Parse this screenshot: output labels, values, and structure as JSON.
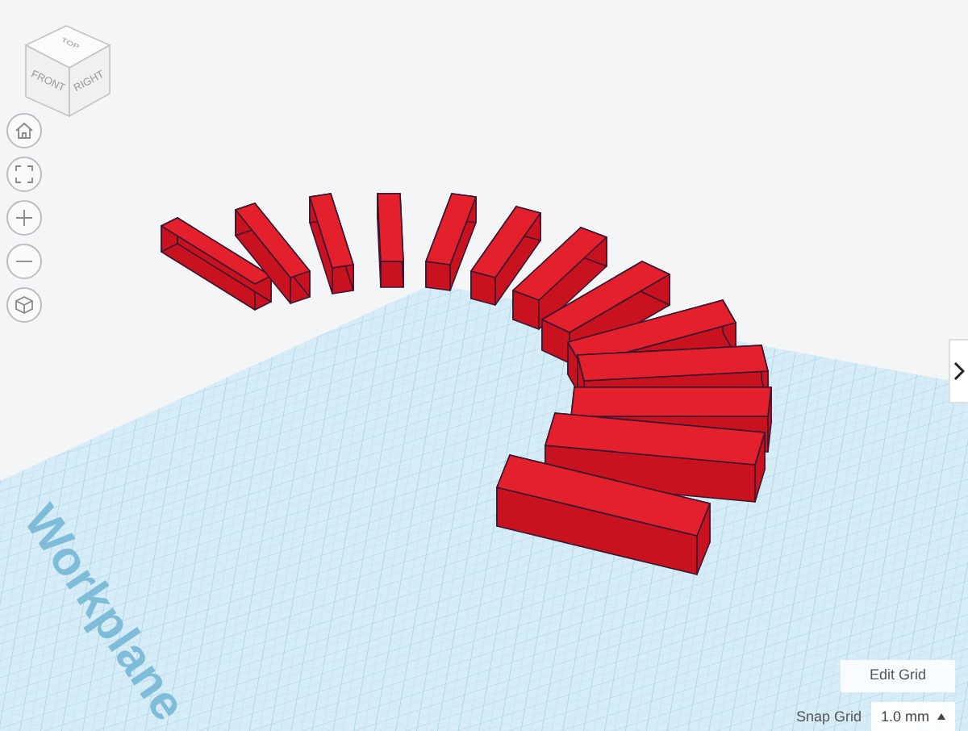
{
  "view_cube": {
    "faces": [
      {
        "kind": "top",
        "label": "TOP"
      },
      {
        "kind": "front",
        "label": "FRONT"
      },
      {
        "kind": "right",
        "label": "RIGHT"
      }
    ]
  },
  "nav_buttons": [
    {
      "kind": "home"
    },
    {
      "kind": "fit"
    },
    {
      "kind": "zoom-in"
    },
    {
      "kind": "zoom-out"
    },
    {
      "kind": "perspective"
    }
  ],
  "workplane": {
    "label": "Workplane"
  },
  "grid_controls": {
    "edit_button": "Edit Grid",
    "snap_label": "Snap Grid",
    "snap_value": "1.0 mm"
  }
}
